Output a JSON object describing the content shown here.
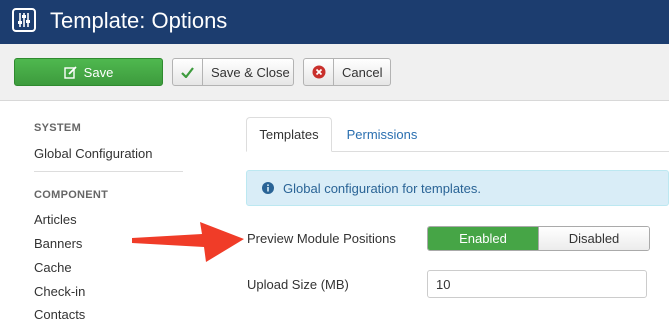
{
  "header": {
    "title": "Template: Options",
    "icon": "options-sliders-icon"
  },
  "toolbar": {
    "save_label": "Save",
    "save_close_label": "Save & Close",
    "cancel_label": "Cancel"
  },
  "sidebar": {
    "sections": [
      {
        "heading": "SYSTEM",
        "items": [
          "Global Configuration"
        ]
      },
      {
        "heading": "COMPONENT",
        "items": [
          "Articles",
          "Banners",
          "Cache",
          "Check-in",
          "Contacts"
        ]
      }
    ]
  },
  "tabs": [
    {
      "label": "Templates",
      "active": true
    },
    {
      "label": "Permissions",
      "active": false
    }
  ],
  "alert": {
    "text": "Global configuration for templates.",
    "icon": "info-circle-icon"
  },
  "form": {
    "preview_label": "Preview Module Positions",
    "preview_options": [
      "Enabled",
      "Disabled"
    ],
    "preview_selected": "Enabled",
    "upload_label": "Upload Size (MB)",
    "upload_value": "10"
  },
  "colors": {
    "header": "#1c3d6f",
    "save_button": "#46a546",
    "toggle_on": "#46a546",
    "alert_bg": "#d9edf7",
    "link": "#2a6fb0",
    "annotation_arrow": "#f03c28"
  }
}
